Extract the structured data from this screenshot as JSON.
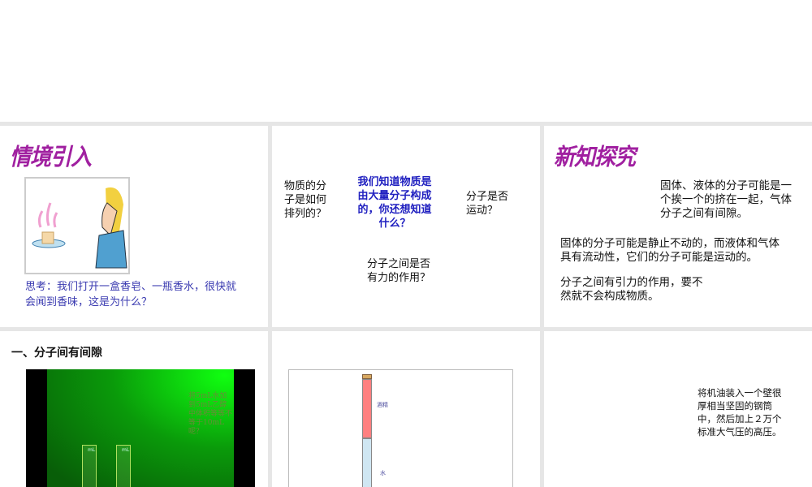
{
  "slide1": {
    "title": "情境引入",
    "caption": "思考：我们打开一盒香皂、一瓶香水，很快就会闻到香味，这是为什么？"
  },
  "slide2": {
    "q_arrange": "物质的分子是如何排列的？",
    "center": "我们知道物质是由大量分子构成的，你还想知道什么？",
    "q_move": "分子是否运动？",
    "q_force": "分子之间是否有力的作用？"
  },
  "slide3": {
    "title": "新知探究",
    "p1": "固体、液体的分子可能是一个挨一个的挤在一起，气体分子之间有间隙。",
    "p2": "固体的分子可能是静止不动的，而液体和气体具有流动性，它们的分子可能是运动的。",
    "p3": "分子之间有引力的作用，要不然就不会构成物质。"
  },
  "slide4": {
    "heading": "一、分子间有间隙",
    "video_text": "将5mL水加到5mL乙醇中体积等等不等于10mL呢？",
    "unit": "mL"
  },
  "slide5": {
    "label_alcohol": "酒精",
    "label_water": "水"
  },
  "slide6": {
    "text": "将机油装入一个壁很厚相当坚固的钢筒中，然后加上２万个标准大气压的高压。"
  }
}
